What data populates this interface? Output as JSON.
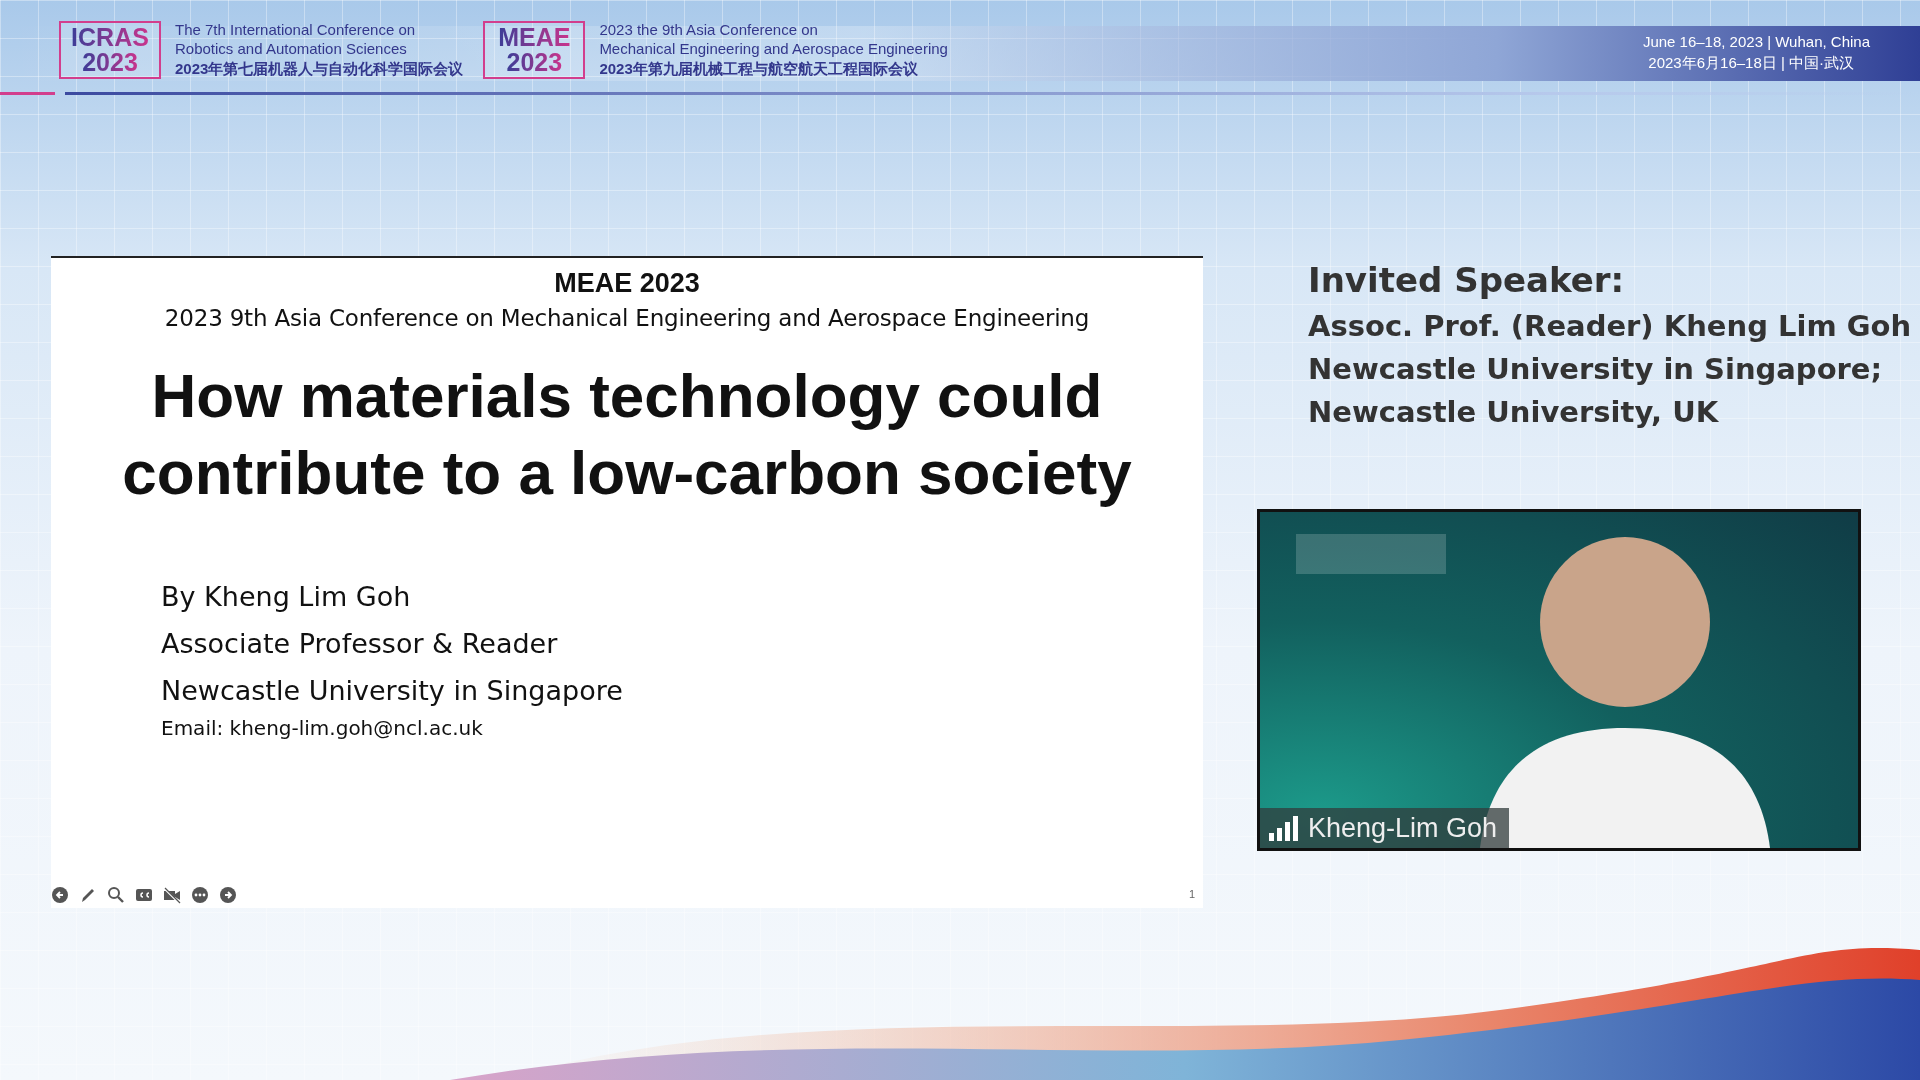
{
  "header": {
    "conferences": [
      {
        "logo_name": "ICRAS",
        "logo_year": "2023",
        "title_lines": [
          "The 7th International Conference on",
          "Robotics and Automation Sciences"
        ],
        "title_zh": "2023年第七届机器人与自动化科学国际会议"
      },
      {
        "logo_name": "MEAE",
        "logo_year": "2023",
        "title_lines": [
          "2023 the 9th Asia Conference on",
          "Mechanical Engineering and Aerospace Engineering"
        ],
        "title_zh": "2023年第九届机械工程与航空航天工程国际会议"
      }
    ],
    "date_lines": [
      "June 16–18, 2023 | Wuhan, China",
      "2023年6月16–18日 | 中国·武汉"
    ]
  },
  "slide": {
    "conference": "MEAE 2023",
    "conference_full": "2023 9th Asia Conference on Mechanical Engineering and Aerospace Engineering",
    "title": "How materials technology could contribute to a low-carbon society",
    "author_lines": [
      "By Kheng Lim Goh",
      "Associate Professor & Reader",
      "Newcastle University in Singapore"
    ],
    "email": "Email: kheng-lim.goh@ncl.ac.uk",
    "page_number": "1",
    "toolbar": [
      {
        "kind": "back"
      },
      {
        "kind": "pen"
      },
      {
        "kind": "zoom"
      },
      {
        "kind": "captions"
      },
      {
        "kind": "video"
      },
      {
        "kind": "more"
      },
      {
        "kind": "forward"
      }
    ]
  },
  "speaker": {
    "heading": "Invited Speaker:",
    "lines": [
      "Assoc. Prof. (Reader) Kheng Lim Goh",
      "Newcastle University in Singapore;",
      "Newcastle University, UK"
    ]
  },
  "video": {
    "participant_name": "Kheng-Lim Goh"
  }
}
